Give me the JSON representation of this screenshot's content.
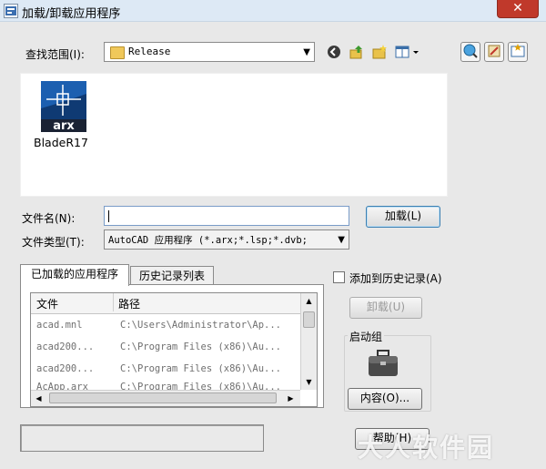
{
  "window": {
    "title": "加载/卸载应用程序",
    "close_glyph": "✕"
  },
  "lookin": {
    "label": "查找范围(I):",
    "value": "Release",
    "toolbar_icons": [
      "back-icon",
      "up-folder-icon",
      "new-folder-icon",
      "view-menu-icon",
      "search-web-icon",
      "tools-icon",
      "favorites-icon"
    ]
  },
  "files": [
    {
      "name": "BladeR17",
      "icon": "arx-file-icon",
      "icon_text": "arx"
    }
  ],
  "filename": {
    "label": "文件名(N):",
    "value": ""
  },
  "filetype": {
    "label": "文件类型(T):",
    "value": "AutoCAD 应用程序 (*.arx;*.lsp;*.dvb;"
  },
  "load_button": "加载(L)",
  "tabs": [
    {
      "label": "已加载的应用程序",
      "active": true
    },
    {
      "label": "历史记录列表",
      "active": false
    }
  ],
  "loaded_list": {
    "columns": [
      "文件",
      "路径"
    ],
    "rows": [
      {
        "file": "acad.mnl",
        "path": "C:\\Users\\Administrator\\Ap..."
      },
      {
        "file": "acad200...",
        "path": "C:\\Program Files (x86)\\Au..."
      },
      {
        "file": "acad200...",
        "path": "C:\\Program Files (x86)\\Au..."
      },
      {
        "file": "AcApp.arx",
        "path": "C:\\Program Files (x86)\\Au..."
      }
    ]
  },
  "add_history": {
    "label": "添加到历史记录(A)",
    "checked": false
  },
  "unload_button": "卸载(U)",
  "startup_group": {
    "label": "启动组",
    "icon": "briefcase-icon",
    "contents_button": "内容(O)..."
  },
  "status_text": "",
  "help_button": "帮助(H)",
  "watermark": "大人软件园"
}
